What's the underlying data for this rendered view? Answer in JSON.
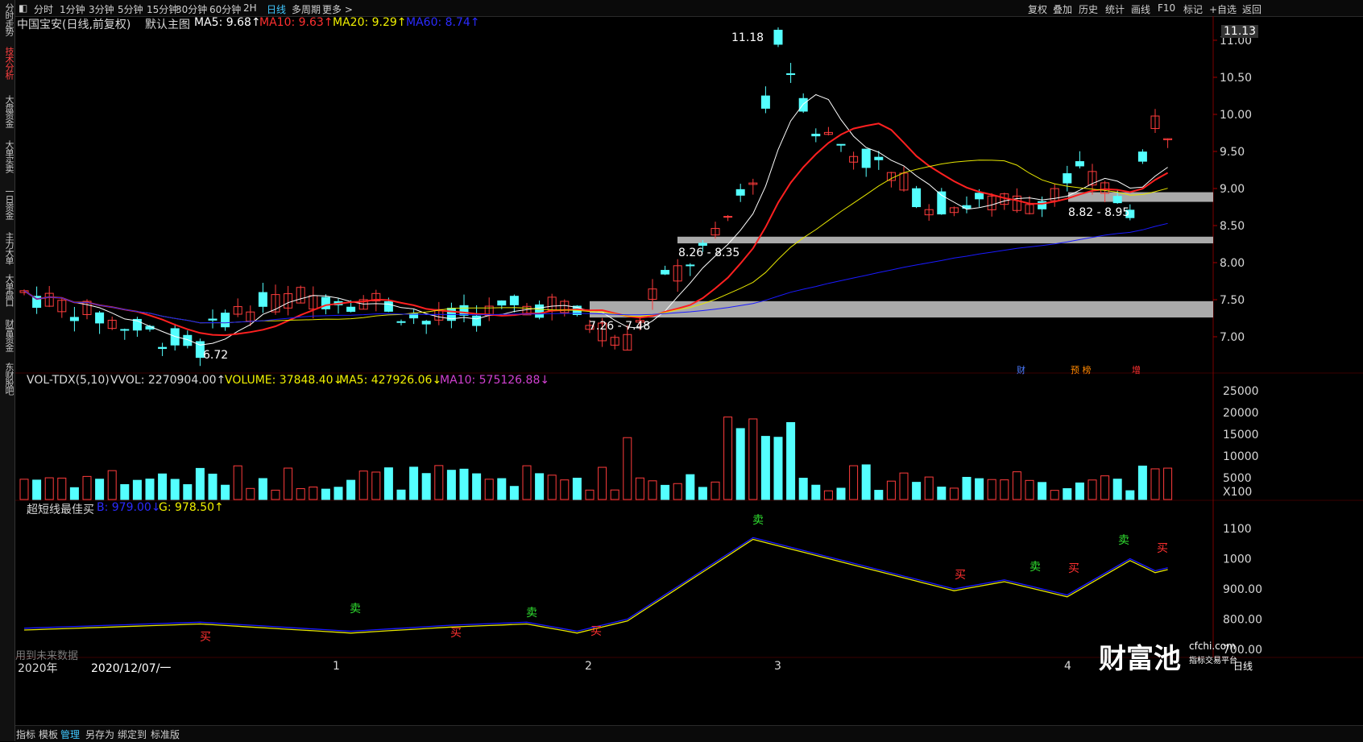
{
  "sidebar": {
    "tabs": [
      "分时走势",
      "技术分析",
      "大盘资金",
      "大单买卖",
      "一日资金",
      "主力大单",
      "大单盘口",
      "财富资金",
      "东财股吧"
    ]
  },
  "toolbar": {
    "periods": [
      "分时",
      "1分钟",
      "3分钟",
      "5分钟",
      "15分钟",
      "30分钟",
      "60分钟",
      "2H",
      "日线",
      "多周期",
      "更多 >"
    ],
    "right": [
      "复权",
      "叠加",
      "历史",
      "统计",
      "画线",
      "F10",
      "标记",
      "+自选",
      "返回"
    ]
  },
  "main": {
    "title": "中国宝安(日线,前复权)",
    "indicator": "默认主图",
    "ma5": "MA5: 9.68↑",
    "ma10": "MA10: 9.63↑",
    "ma20": "MA20: 9.29↑",
    "ma60": "MA60: 8.74↑",
    "price_top": "11.13",
    "yticks": [
      "11.00",
      "10.50",
      "10.00",
      "9.50",
      "9.00",
      "8.50",
      "8.00",
      "7.50",
      "7.00"
    ],
    "annotations": {
      "high": "11.18",
      "low": "6.72",
      "zone1": "7.26 - 7.48",
      "zone2": "8.26 - 8.35",
      "zone3": "8.82 - 8.95"
    },
    "events": [
      "财",
      "预 榜",
      "增"
    ]
  },
  "volume": {
    "title": "VOL-TDX(5,10)",
    "vvol": "VVOL: 2270904.00↑",
    "volume": "VOLUME: 37848.40↓",
    "ma5": "MA5: 427926.06↓",
    "ma10": "MA10: 575126.88↓",
    "yticks": [
      "25000",
      "20000",
      "15000",
      "10000",
      "5000",
      "X100"
    ]
  },
  "sub": {
    "title": "超短线最佳买",
    "b": "B: 979.00↓",
    "g": "G: 978.50↑",
    "yticks": [
      "1100",
      "1000",
      "900.00",
      "800.00",
      "700.00"
    ],
    "signals": [
      "买",
      "卖",
      "买",
      "卖",
      "买",
      "卖",
      "买",
      "卖",
      "买",
      "卖",
      "买"
    ],
    "watermark": "用到未来数据"
  },
  "xaxis": {
    "year": "2020年",
    "cursor": "2020/12/07/一",
    "months": [
      "1",
      "2",
      "3",
      "4"
    ]
  },
  "bottombar": {
    "items": [
      "指标",
      "模板",
      "管理",
      "另存为",
      "绑定到",
      "标准版"
    ]
  },
  "logo": {
    "name": "财富池",
    "site": "cfchi.com",
    "tagline": "指标交易平台",
    "mode": "日线"
  },
  "colors": {
    "up": "#ff3c3c",
    "down": "#54ffff",
    "ma5": "#ffffff",
    "ma10": "#ff2020",
    "ma20": "#e6e600",
    "ma60": "#1a1aff",
    "zone": "#c8c8c8"
  }
}
